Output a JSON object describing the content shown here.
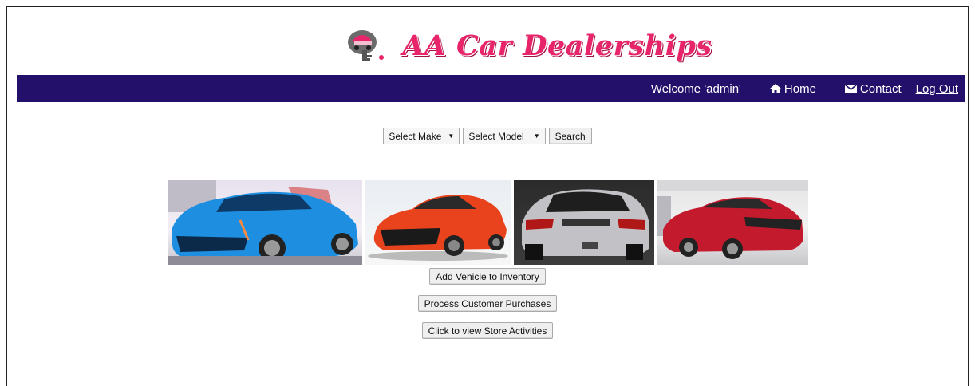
{
  "header": {
    "title": "AA Car Dealerships",
    "logo_icon": "car-key-logo-icon"
  },
  "nav": {
    "welcome": "Welcome 'admin'",
    "home": "Home",
    "contact": "Contact",
    "logout": "Log Out",
    "home_icon": "home-icon",
    "contact_icon": "envelope-icon",
    "bg_color": "#23106b"
  },
  "search": {
    "make_selected": "Select Make",
    "model_selected": "Select Model",
    "button": "Search"
  },
  "gallery": {
    "cars": [
      {
        "color": "#1e8fe0",
        "name": "blue-concept-sedan"
      },
      {
        "color": "#e8431c",
        "name": "orange-sedan"
      },
      {
        "color": "#b8b8bc",
        "name": "silver-hatchback"
      },
      {
        "color": "#c41a2e",
        "name": "red-sedan"
      }
    ]
  },
  "actions": {
    "add_vehicle": "Add Vehicle to Inventory",
    "process_purchases": "Process Customer Purchases",
    "view_activities": "Click to view Store Activities"
  }
}
